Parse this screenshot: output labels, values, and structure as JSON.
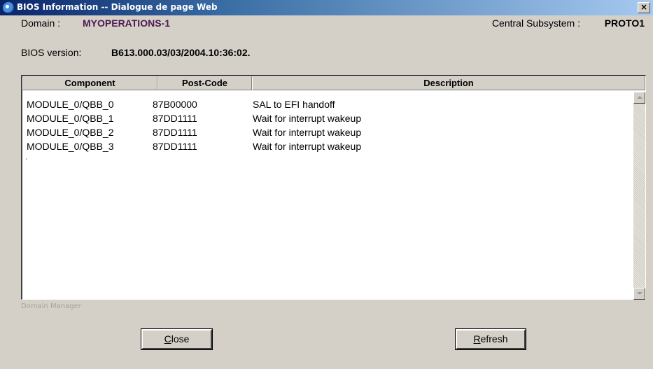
{
  "window": {
    "title": "BIOS Information -- Dialogue de page Web",
    "close_glyph": "×"
  },
  "header": {
    "domain_label": "Domain :",
    "domain_value": "MYOPERATIONS-1",
    "subsystem_label": "Central Subsystem :",
    "subsystem_value": "PROTO1",
    "bios_label": "BIOS version:",
    "bios_value": "B613.000.03/03/2004.10:36:02."
  },
  "table": {
    "columns": [
      "Component",
      "Post-Code",
      "Description"
    ],
    "rows": [
      {
        "component": "MODULE_0/QBB_0",
        "postcode": "87B00000",
        "description": "SAL to EFI handoff"
      },
      {
        "component": "MODULE_0/QBB_1",
        "postcode": "87DD1111",
        "description": "Wait for interrupt wakeup"
      },
      {
        "component": "MODULE_0/QBB_2",
        "postcode": "87DD1111",
        "description": "Wait for interrupt wakeup"
      },
      {
        "component": "MODULE_0/QBB_3",
        "postcode": "87DD1111",
        "description": "Wait for interrupt wakeup"
      }
    ]
  },
  "footer": {
    "watermark": "Domain Manager",
    "close_button": {
      "accesskey": "C",
      "rest": "lose"
    },
    "refresh_button": {
      "accesskey": "R",
      "rest": "efresh"
    }
  },
  "icons": {
    "title_icon": "ie-icon",
    "scroll_up": "scroll-up-arrow-icon",
    "scroll_down": "scroll-down-arrow-icon"
  }
}
